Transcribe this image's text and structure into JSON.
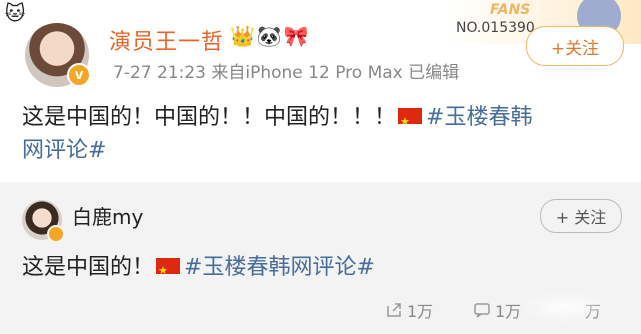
{
  "post": {
    "username": "演员王一哲",
    "emoji": "👑🐼🎀",
    "meta": "7-27 21:23  来自iPhone 12 Pro Max  已编辑",
    "follow_label": "+关注",
    "fans_card": {
      "label": "FANS",
      "number": "NO.015390"
    },
    "text_part": "这是中国的！中国的！！中国的！！！",
    "tag_line1": "#玉楼春韩",
    "tag_line2": "网评论#"
  },
  "repost": {
    "username": "白鹿my",
    "follow_label": "+ 关注",
    "text_part": "这是中国的！",
    "tag": "#玉楼春韩网评论#",
    "stats": {
      "reposts": "1万",
      "comments": "1万",
      "likes": "万"
    }
  },
  "colors": {
    "username": "#e8652a",
    "hashtag": "#466d9c",
    "follow_border": "#f0b66a"
  }
}
